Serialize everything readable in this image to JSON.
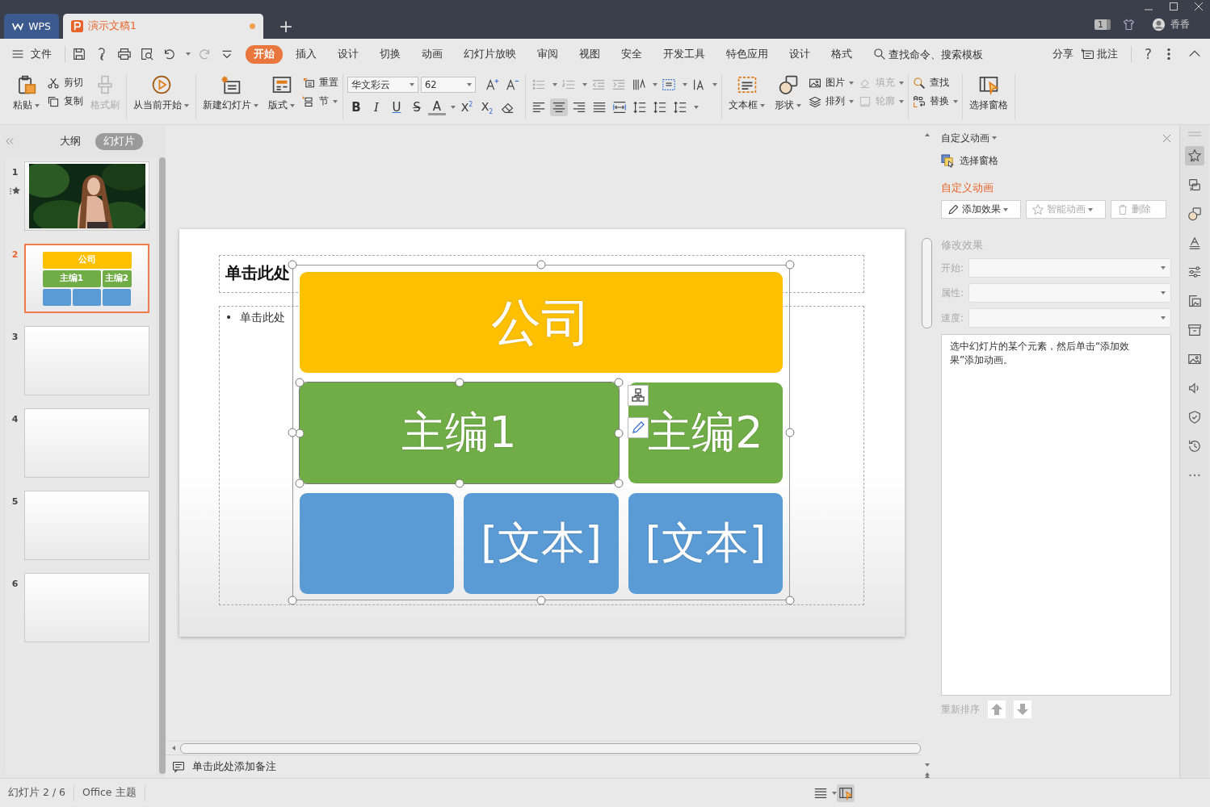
{
  "title_bar": {
    "tabs": [
      {
        "label": "WPS",
        "kind": "home",
        "selected": false,
        "unsaved": false
      },
      {
        "label": "演示文稿1",
        "kind": "document",
        "selected": true,
        "unsaved": true
      }
    ],
    "new_tab": "+",
    "badge": "1",
    "user": "香香"
  },
  "menu_bar": {
    "file": "文件",
    "tabs": [
      {
        "label": "开始",
        "selected": true
      },
      {
        "label": "插入",
        "selected": false
      },
      {
        "label": "设计",
        "selected": false
      },
      {
        "label": "切换",
        "selected": false
      },
      {
        "label": "动画",
        "selected": false
      },
      {
        "label": "幻灯片放映",
        "selected": false
      },
      {
        "label": "审阅",
        "selected": false
      },
      {
        "label": "视图",
        "selected": false
      },
      {
        "label": "安全",
        "selected": false
      },
      {
        "label": "开发工具",
        "selected": false
      },
      {
        "label": "特色应用",
        "selected": false
      },
      {
        "label": "设计",
        "selected": false
      },
      {
        "label": "格式",
        "selected": false
      }
    ],
    "search": {
      "placeholder": "查找命令、搜索模板"
    },
    "share": "分享",
    "comment": "批注",
    "help": "?"
  },
  "ribbon": {
    "paste": {
      "label": "粘贴",
      "dropdown": true,
      "disabled": false
    },
    "cut": {
      "label": "剪切",
      "dropdown": false,
      "disabled": false
    },
    "copy": {
      "label": "复制",
      "dropdown": false,
      "disabled": false
    },
    "format_painter": {
      "label": "格式刷",
      "dropdown": false,
      "disabled": true
    },
    "play_from_current": {
      "label": "从当前开始",
      "dropdown": true,
      "disabled": false
    },
    "new_slide": {
      "label": "新建幻灯片",
      "dropdown": true,
      "disabled": false
    },
    "layout": {
      "label": "版式",
      "dropdown": true,
      "disabled": false
    },
    "reset": {
      "label": "重置",
      "dropdown": false,
      "disabled": false
    },
    "section": {
      "label": "节",
      "dropdown": true,
      "disabled": false
    },
    "font_name": "华文彩云",
    "font_size": "62",
    "format_buttons": [
      {
        "label": "B",
        "kind": "bold"
      },
      {
        "label": "I",
        "kind": "italic"
      },
      {
        "label": "U",
        "kind": "underline"
      },
      {
        "label": "S",
        "kind": "strike"
      },
      {
        "label": "A",
        "kind": "color"
      },
      {
        "label": "X$^{2}$",
        "kind": "script"
      },
      {
        "label": "X$_{2}$",
        "kind": "script"
      }
    ],
    "align_buttons": [
      {
        "selected": false
      },
      {
        "selected": true
      },
      {
        "selected": false
      },
      {
        "selected": false
      },
      {
        "selected": false
      }
    ],
    "text_box": {
      "label": "文本框",
      "dropdown": true,
      "disabled": false
    },
    "shape": {
      "label": "形状",
      "dropdown": true,
      "disabled": false
    },
    "picture": {
      "label": "图片",
      "dropdown": true,
      "disabled": false
    },
    "arrange": {
      "label": "排列",
      "dropdown": true,
      "disabled": false
    },
    "fill": {
      "label": "填充",
      "dropdown": true,
      "disabled": true
    },
    "outline": {
      "label": "轮廓",
      "dropdown": true,
      "disabled": true
    },
    "find": {
      "label": "查找",
      "dropdown": false,
      "disabled": false
    },
    "replace": {
      "label": "替换",
      "dropdown": true,
      "disabled": false
    },
    "selection_pane": {
      "label": "选择窗格",
      "dropdown": false,
      "disabled": false
    }
  },
  "slides_panel": {
    "tabs": [
      {
        "label": "大纲",
        "selected": false
      },
      {
        "label": "幻灯片",
        "selected": true
      }
    ],
    "slides": [
      {
        "number": "1",
        "kind": "picture",
        "selected": false,
        "animated": true
      },
      {
        "number": "2",
        "kind": "smartart",
        "selected": true,
        "animated": false,
        "labels": [
          "公司",
          "主编1",
          "主编2"
        ]
      },
      {
        "number": "3",
        "kind": "blank",
        "selected": false,
        "animated": false
      },
      {
        "number": "4",
        "kind": "blank",
        "selected": false,
        "animated": false
      },
      {
        "number": "5",
        "kind": "blank",
        "selected": false,
        "animated": false
      },
      {
        "number": "6",
        "kind": "blank",
        "selected": false,
        "animated": false
      }
    ]
  },
  "slide": {
    "title_placeholder": "单击此处",
    "bullet": "•",
    "body_placeholder": "单击此处",
    "smartart": {
      "root": {
        "text": "公司",
        "color": "#ffc000",
        "selected": false,
        "children": [
          {
            "text": "主编1",
            "color": "#70ad47",
            "selected": true,
            "children": [
              {
                "color": "#5b9bd5",
                "selected": false
              },
              {
                "text": "[文本]",
                "color": "#5b9bd5",
                "selected": false
              }
            ]
          },
          {
            "text": "主编2",
            "color": "#70ad47",
            "selected": false,
            "children": [
              {
                "text": "[文本]",
                "color": "#5b9bd5",
                "selected": false
              }
            ]
          }
        ]
      }
    }
  },
  "notes": {
    "placeholder": "单击此处添加备注"
  },
  "task_pane": {
    "title": "自定义动画",
    "selection_pane": "选择窗格",
    "section_title": "自定义动画",
    "buttons": [
      {
        "label": "添加效果",
        "disabled": false,
        "dropdown": true
      },
      {
        "label": "智能动画",
        "disabled": true,
        "dropdown": true
      },
      {
        "label": "删除",
        "disabled": true,
        "dropdown": false
      }
    ],
    "modify_title": "修改效果",
    "fields": [
      {
        "label": "开始:",
        "disabled": true
      },
      {
        "label": "属性:",
        "disabled": true
      },
      {
        "label": "速度:",
        "disabled": true
      }
    ],
    "message": "选中幻灯片的某个元素，然后单击“添加效果”添加动画。",
    "reorder": "重新排序",
    "reorder_buttons": [
      {
        "kind": "up",
        "disabled": true
      },
      {
        "kind": "down",
        "disabled": true
      }
    ]
  },
  "side_toolbar": [
    {
      "selected": true
    },
    {
      "selected": false
    },
    {
      "selected": false
    },
    {
      "selected": false
    },
    {
      "selected": false
    },
    {
      "selected": false
    },
    {
      "selected": false
    },
    {
      "selected": false
    },
    {
      "selected": false
    },
    {
      "selected": false
    },
    {
      "selected": false
    }
  ],
  "status_bar": {
    "slide_indicator": "幻灯片 2 / 6",
    "theme": "Office 主题"
  }
}
